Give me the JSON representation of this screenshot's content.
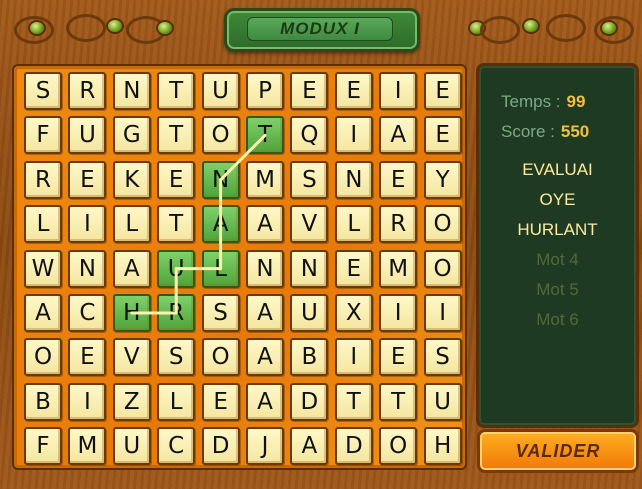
{
  "title": "MODUX I",
  "grid": [
    [
      "S",
      "R",
      "N",
      "T",
      "U",
      "P",
      "E",
      "E",
      "I",
      "E"
    ],
    [
      "F",
      "U",
      "G",
      "T",
      "O",
      "T",
      "Q",
      "I",
      "A",
      "E"
    ],
    [
      "R",
      "E",
      "K",
      "E",
      "N",
      "M",
      "S",
      "N",
      "E",
      "Y"
    ],
    [
      "L",
      "I",
      "L",
      "T",
      "A",
      "A",
      "V",
      "L",
      "R",
      "O"
    ],
    [
      "W",
      "N",
      "A",
      "U",
      "L",
      "N",
      "N",
      "E",
      "M",
      "O"
    ],
    [
      "A",
      "C",
      "H",
      "R",
      "S",
      "A",
      "U",
      "X",
      "I",
      "I"
    ],
    [
      "O",
      "E",
      "V",
      "S",
      "O",
      "A",
      "B",
      "I",
      "E",
      "S"
    ],
    [
      "B",
      "I",
      "Z",
      "L",
      "E",
      "A",
      "D",
      "T",
      "T",
      "U"
    ],
    [
      "F",
      "M",
      "U",
      "C",
      "D",
      "J",
      "A",
      "D",
      "O",
      "H"
    ]
  ],
  "selected_path": [
    [
      5,
      2
    ],
    [
      5,
      3
    ],
    [
      4,
      3
    ],
    [
      4,
      4
    ],
    [
      3,
      4
    ],
    [
      2,
      4
    ],
    [
      1,
      5
    ]
  ],
  "stats": {
    "time_label": "Temps :",
    "time_value": "99",
    "score_label": "Score :",
    "score_value": "550"
  },
  "words": [
    {
      "text": "EVALUAI",
      "found": true
    },
    {
      "text": "OYE",
      "found": true
    },
    {
      "text": "HURLANT",
      "found": true
    },
    {
      "text": "Mot 4",
      "found": false
    },
    {
      "text": "Mot 5",
      "found": false
    },
    {
      "text": "Mot 6",
      "found": false
    }
  ],
  "button_label": "VALIDER",
  "colors": {
    "selected_tile": "#5fb848",
    "found_word": "#ffe8a0",
    "hidden_word": "#4f6a3a",
    "stat_value": "#f0c040"
  }
}
